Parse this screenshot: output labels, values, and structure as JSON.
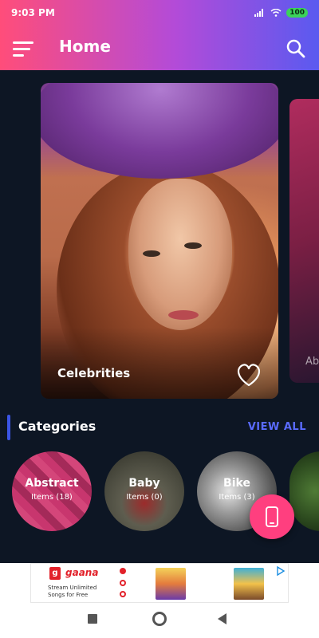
{
  "status_bar": {
    "time": "9:03 PM",
    "battery": "100"
  },
  "header": {
    "title": "Home"
  },
  "featured": [
    {
      "label": "Celebrities"
    },
    {
      "label": "Ab"
    }
  ],
  "categories_section": {
    "title": "Categories",
    "view_all": "VIEW ALL"
  },
  "categories": [
    {
      "name": "Abstract",
      "count": "Items (18)"
    },
    {
      "name": "Baby",
      "count": "Items (0)"
    },
    {
      "name": "Bike",
      "count": "Items (3)"
    },
    {
      "name": "",
      "count": ""
    }
  ],
  "ad": {
    "brand": "gaana",
    "logo_letter": "g",
    "line1": "Stream Unlimited",
    "line2": "Songs for Free"
  },
  "colors": {
    "accent": "#3b55e6",
    "fab": "#ff3f7f",
    "header_gradient_start": "#ff4d7a",
    "header_gradient_end": "#5a5af0"
  }
}
